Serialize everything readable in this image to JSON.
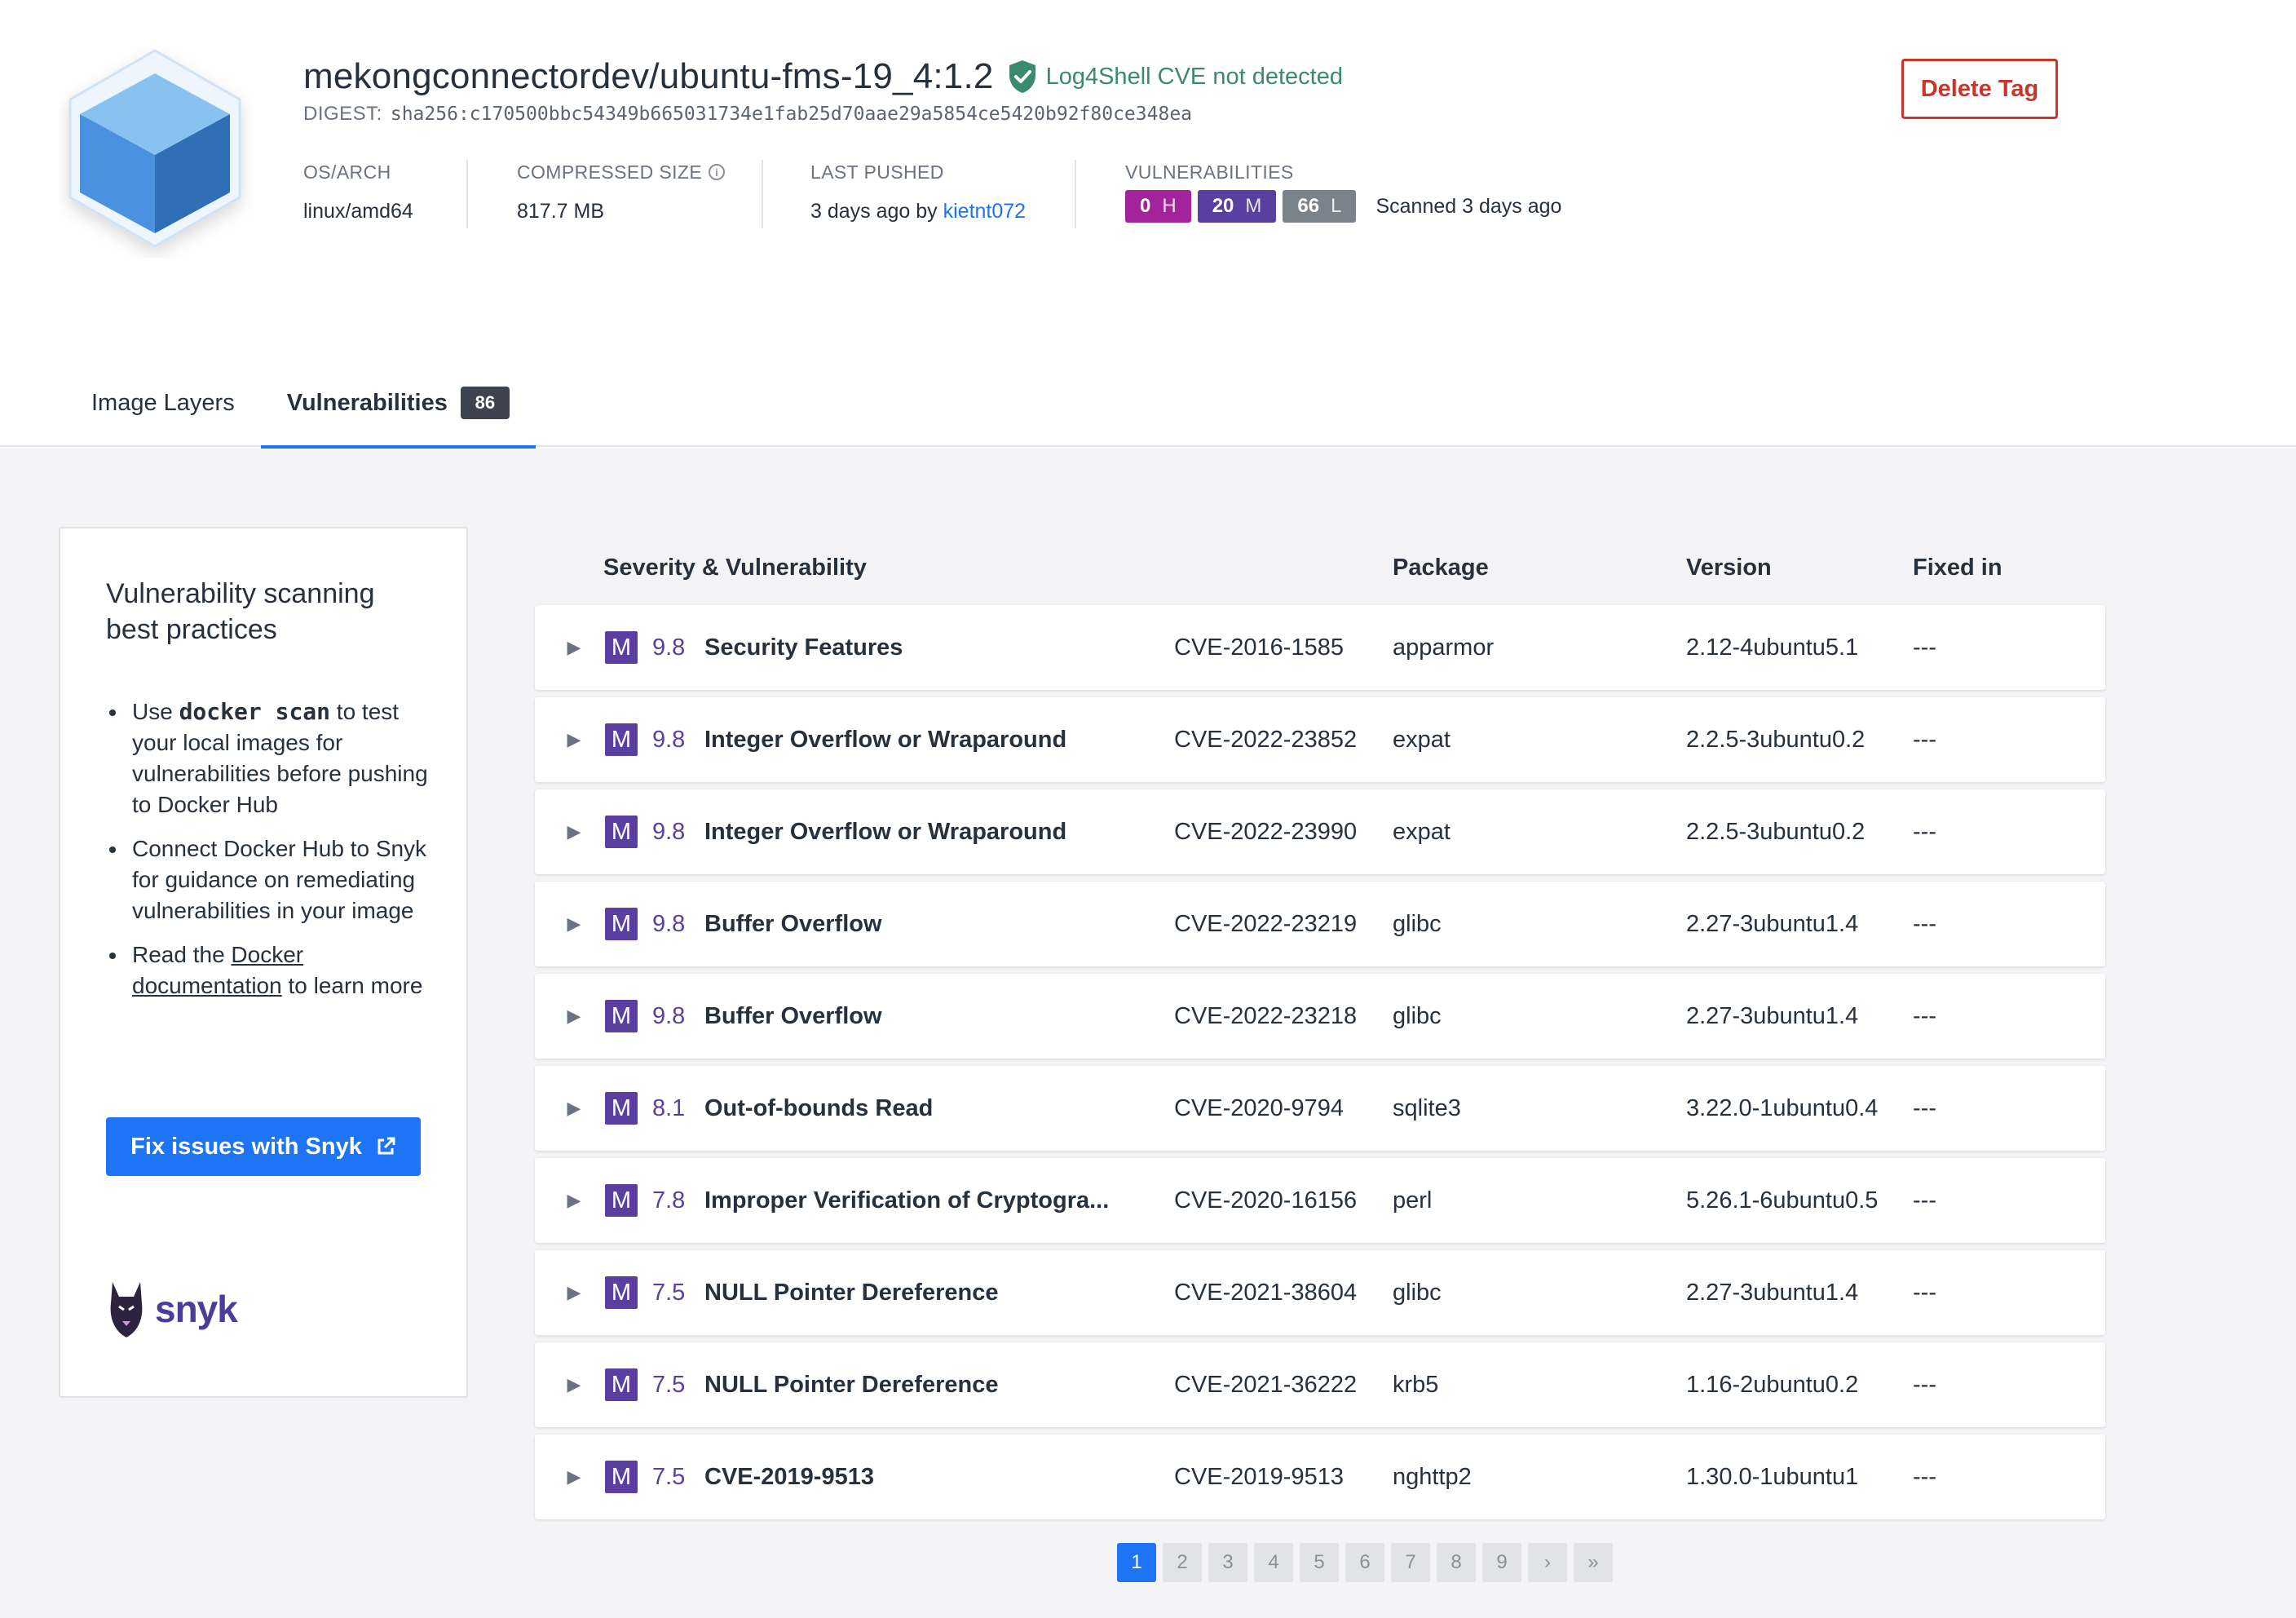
{
  "header": {
    "repo_title": "mekongconnectordev/ubuntu-fms-19_4:1.2",
    "log4shell_status": "Log4Shell CVE not detected",
    "digest_label": "DIGEST:",
    "digest_value": "sha256:c170500bbc54349b665031734e1fab25d70aae29a5854ce5420b92f80ce348ea",
    "delete_label": "Delete Tag",
    "os_arch_label": "OS/ARCH",
    "os_arch_value": "linux/amd64",
    "compressed_label": "COMPRESSED SIZE",
    "compressed_info": "i",
    "compressed_value": "817.7 MB",
    "pushed_label": "LAST PUSHED",
    "pushed_prefix": "3 days ago by",
    "pushed_user": "kietnt072",
    "vuln_label": "VULNERABILITIES",
    "vuln_high_count": "0",
    "vuln_high_letter": "H",
    "vuln_med_count": "20",
    "vuln_med_letter": "M",
    "vuln_low_count": "66",
    "vuln_low_letter": "L",
    "scanned": "Scanned 3 days ago",
    "colors": {
      "high": "#a3249a",
      "medium": "#5b3fa0",
      "low": "#7a828c",
      "accent": "#1d74f5",
      "danger": "#c9352b"
    }
  },
  "tabs": {
    "layers": "Image Layers",
    "vulnerabilities": "Vulnerabilities",
    "vuln_count": "86"
  },
  "sidebar": {
    "title": "Vulnerability scanning best practices",
    "b1_pre": "Use",
    "b1_code": "docker scan",
    "b1_post": "to test your local images for vulnerabilities before pushing to Docker Hub",
    "b2": "Connect Docker Hub to Snyk for guidance on remediating vulnerabilities in your image",
    "b3_pre": "Read the",
    "b3_link": "Docker documentation",
    "b3_post": "to learn more",
    "button": "Fix issues with Snyk",
    "logo_text": "snyk"
  },
  "table": {
    "headers": {
      "severity": "Severity & Vulnerability",
      "package": "Package",
      "version": "Version",
      "fixed": "Fixed in"
    },
    "rows": [
      {
        "sev": "M",
        "score": "9.8",
        "name": "Security Features",
        "cve": "CVE-2016-1585",
        "pkg": "apparmor",
        "ver": "2.12-4ubuntu5.1",
        "fix": "---"
      },
      {
        "sev": "M",
        "score": "9.8",
        "name": "Integer Overflow or Wraparound",
        "cve": "CVE-2022-23852",
        "pkg": "expat",
        "ver": "2.2.5-3ubuntu0.2",
        "fix": "---"
      },
      {
        "sev": "M",
        "score": "9.8",
        "name": "Integer Overflow or Wraparound",
        "cve": "CVE-2022-23990",
        "pkg": "expat",
        "ver": "2.2.5-3ubuntu0.2",
        "fix": "---"
      },
      {
        "sev": "M",
        "score": "9.8",
        "name": "Buffer Overflow",
        "cve": "CVE-2022-23219",
        "pkg": "glibc",
        "ver": "2.27-3ubuntu1.4",
        "fix": "---"
      },
      {
        "sev": "M",
        "score": "9.8",
        "name": "Buffer Overflow",
        "cve": "CVE-2022-23218",
        "pkg": "glibc",
        "ver": "2.27-3ubuntu1.4",
        "fix": "---"
      },
      {
        "sev": "M",
        "score": "8.1",
        "name": "Out-of-bounds Read",
        "cve": "CVE-2020-9794",
        "pkg": "sqlite3",
        "ver": "3.22.0-1ubuntu0.4",
        "fix": "---"
      },
      {
        "sev": "M",
        "score": "7.8",
        "name": "Improper Verification of Cryptogra...",
        "cve": "CVE-2020-16156",
        "pkg": "perl",
        "ver": "5.26.1-6ubuntu0.5",
        "fix": "---"
      },
      {
        "sev": "M",
        "score": "7.5",
        "name": "NULL Pointer Dereference",
        "cve": "CVE-2021-38604",
        "pkg": "glibc",
        "ver": "2.27-3ubuntu1.4",
        "fix": "---"
      },
      {
        "sev": "M",
        "score": "7.5",
        "name": "NULL Pointer Dereference",
        "cve": "CVE-2021-36222",
        "pkg": "krb5",
        "ver": "1.16-2ubuntu0.2",
        "fix": "---"
      },
      {
        "sev": "M",
        "score": "7.5",
        "name": "CVE-2019-9513",
        "cve": "CVE-2019-9513",
        "pkg": "nghttp2",
        "ver": "1.30.0-1ubuntu1",
        "fix": "---"
      }
    ]
  },
  "pagination": {
    "pages": [
      "1",
      "2",
      "3",
      "4",
      "5",
      "6",
      "7",
      "8",
      "9"
    ],
    "current": "1",
    "next": "›",
    "last": "»"
  }
}
